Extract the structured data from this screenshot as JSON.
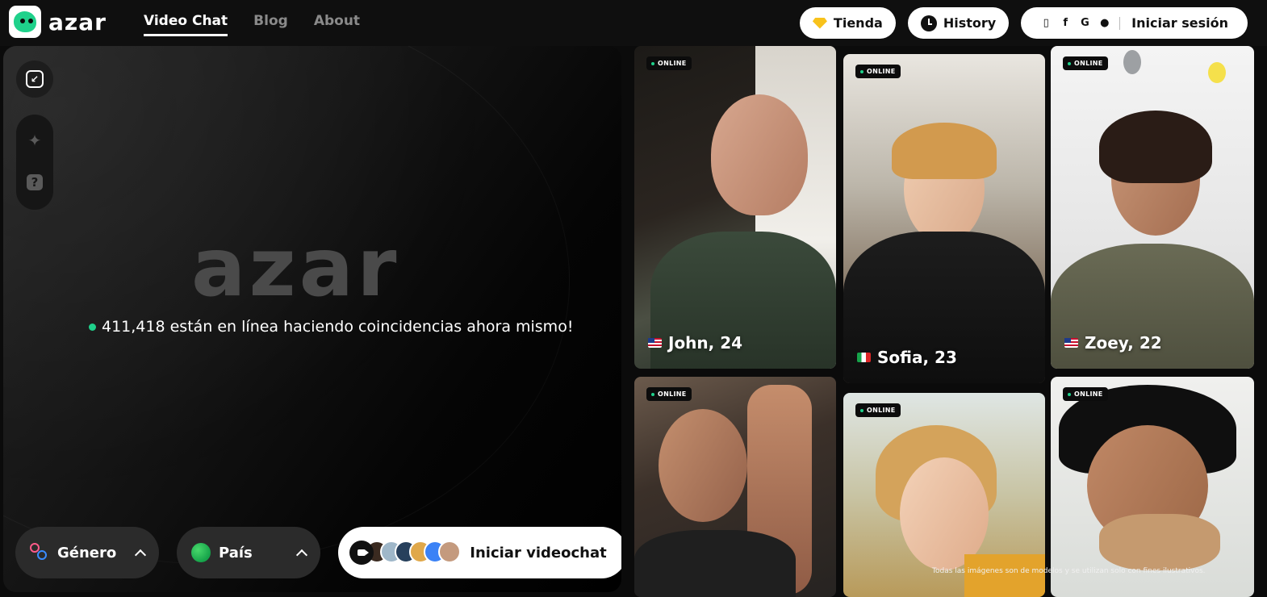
{
  "header": {
    "brand": "azar",
    "nav": [
      "Video Chat",
      "Blog",
      "About"
    ],
    "store_label": "Tienda",
    "history_label": "History",
    "login_label": "Iniciar sesión",
    "login_icons": [
      "phone-icon",
      "facebook-icon",
      "google-icon",
      "apple-icon"
    ]
  },
  "hero": {
    "brand": "azar",
    "online_text": "411,418 están en línea haciendo coincidencias ahora mismo!"
  },
  "controls": {
    "gender_label": "Género",
    "country_label": "País",
    "start_label": "Iniciar videochat"
  },
  "profiles": [
    {
      "name": "John, 24",
      "flag": "us",
      "status": "ONLINE"
    },
    {
      "name": "Sofia, 23",
      "flag": "it",
      "status": "ONLINE"
    },
    {
      "name": "Zoey, 22",
      "flag": "us",
      "status": "ONLINE"
    },
    {
      "status": "ONLINE"
    },
    {
      "status": "ONLINE"
    },
    {
      "status": "ONLINE"
    }
  ],
  "disclaimer": "Todas las imágenes son de modelos y se utilizan solo con fines ilustrativos.",
  "colors": {
    "accent": "#1fd18b",
    "store_gem": "#f8c21b"
  }
}
